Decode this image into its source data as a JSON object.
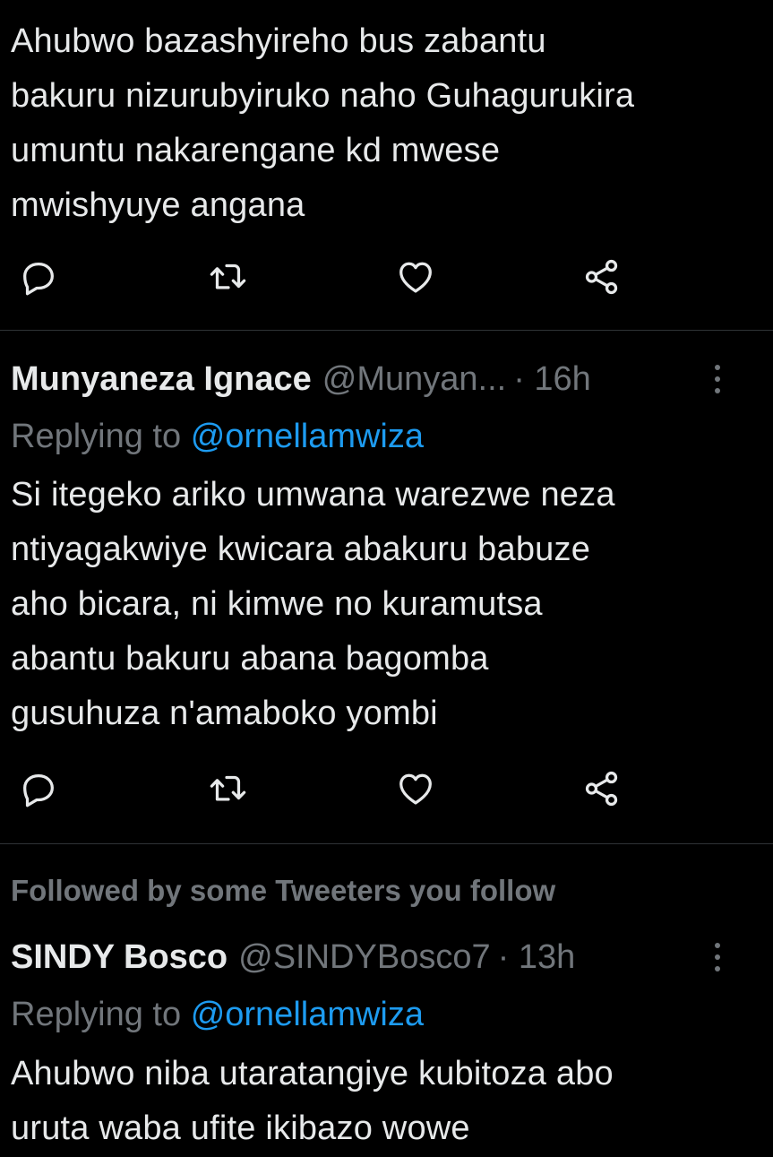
{
  "tweets": [
    {
      "text_lines": [
        "Ahubwo bazashyireho bus zabantu",
        "bakuru nizurubyiruko naho Guhagurukira",
        "umuntu nakarengane kd mwese",
        "mwishyuye angana"
      ]
    },
    {
      "display_name": "Munyaneza Ignace",
      "handle": "@Munyan...",
      "time": "· 16h",
      "replying_prefix": "Replying to",
      "replying_to": "@ornellamwiza",
      "text_lines": [
        "Si itegeko ariko umwana warezwe neza",
        "ntiyagakwiye kwicara abakuru babuze",
        "aho bicara, ni kimwe no kuramutsa",
        "abantu bakuru abana bagomba",
        "gusuhuza n'amaboko yombi"
      ]
    },
    {
      "social_context": "Followed by some Tweeters you follow",
      "display_name": "SINDY Bosco",
      "handle": "@SINDYBosco7",
      "time": "· 13h",
      "replying_prefix": "Replying to",
      "replying_to": "@ornellamwiza",
      "text_lines": [
        "Ahubwo niba utaratangiye kubitoza abo",
        "uruta waba ufite ikibazo wowe"
      ]
    }
  ],
  "colors": {
    "background": "#000000",
    "text": "#e7e9ea",
    "secondary": "#71767b",
    "link": "#1d9bf0",
    "divider": "#2f3336"
  },
  "icons": [
    "reply-icon",
    "retweet-icon",
    "like-icon",
    "share-icon",
    "more-icon"
  ]
}
